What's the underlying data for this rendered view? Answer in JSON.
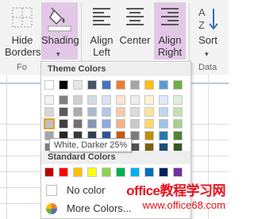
{
  "ribbon": {
    "hide_borders": "Hide\nBorders",
    "shading": "Shading",
    "align_left": "Align\nLeft",
    "center": "Center",
    "align_right": "Align\nRight",
    "sort": "Sort",
    "group_font": "Fo",
    "group_data": "Data"
  },
  "menu": {
    "theme_header": "Theme Colors",
    "standard_header": "Standard Colors",
    "no_color": "No color",
    "more_colors": "More Colors..."
  },
  "tooltip": "White, Darker 25%",
  "watermark": {
    "line1": "office教程学习网",
    "line2": "www.office68.com"
  },
  "theme_columns": [
    [
      "#ffffff",
      "#f2f2f2",
      "#d8d8d8",
      "#bfbfbf",
      "#a5a5a5",
      "#7f7f7f"
    ],
    [
      "#000000",
      "#7f7f7f",
      "#595959",
      "#3f3f3f",
      "#262626",
      "#0c0c0c"
    ],
    [
      "#e7e6e6",
      "#d0cece",
      "#aeaaaa",
      "#757070",
      "#3a3838",
      "#171616"
    ],
    [
      "#44546a",
      "#d6dce4",
      "#adb9ca",
      "#8496b0",
      "#323f4f",
      "#222a35"
    ],
    [
      "#4472c4",
      "#d9e2f3",
      "#b4c7e7",
      "#8eaadb",
      "#2f5496",
      "#1f3864"
    ],
    [
      "#ed7d31",
      "#fbe5d6",
      "#f7cbac",
      "#f4b183",
      "#c55a11",
      "#843c0c"
    ],
    [
      "#a5a5a5",
      "#ededed",
      "#dbdbdb",
      "#c9c9c9",
      "#7b7b7b",
      "#525252"
    ],
    [
      "#ffc000",
      "#fff2cc",
      "#fee599",
      "#ffd966",
      "#bf8f00",
      "#7f6000"
    ],
    [
      "#5b9bd5",
      "#deebf6",
      "#bdd7ee",
      "#9dc3e6",
      "#2e75b5",
      "#1e4e79"
    ],
    [
      "#70ad47",
      "#e2efd9",
      "#c5e0b3",
      "#a8d08d",
      "#538135",
      "#375623"
    ]
  ],
  "standard_colors": [
    "#c00000",
    "#ff0000",
    "#ffc000",
    "#ffff00",
    "#92d050",
    "#00b050",
    "#00b0f0",
    "#0070c0",
    "#002060",
    "#7030a0"
  ]
}
